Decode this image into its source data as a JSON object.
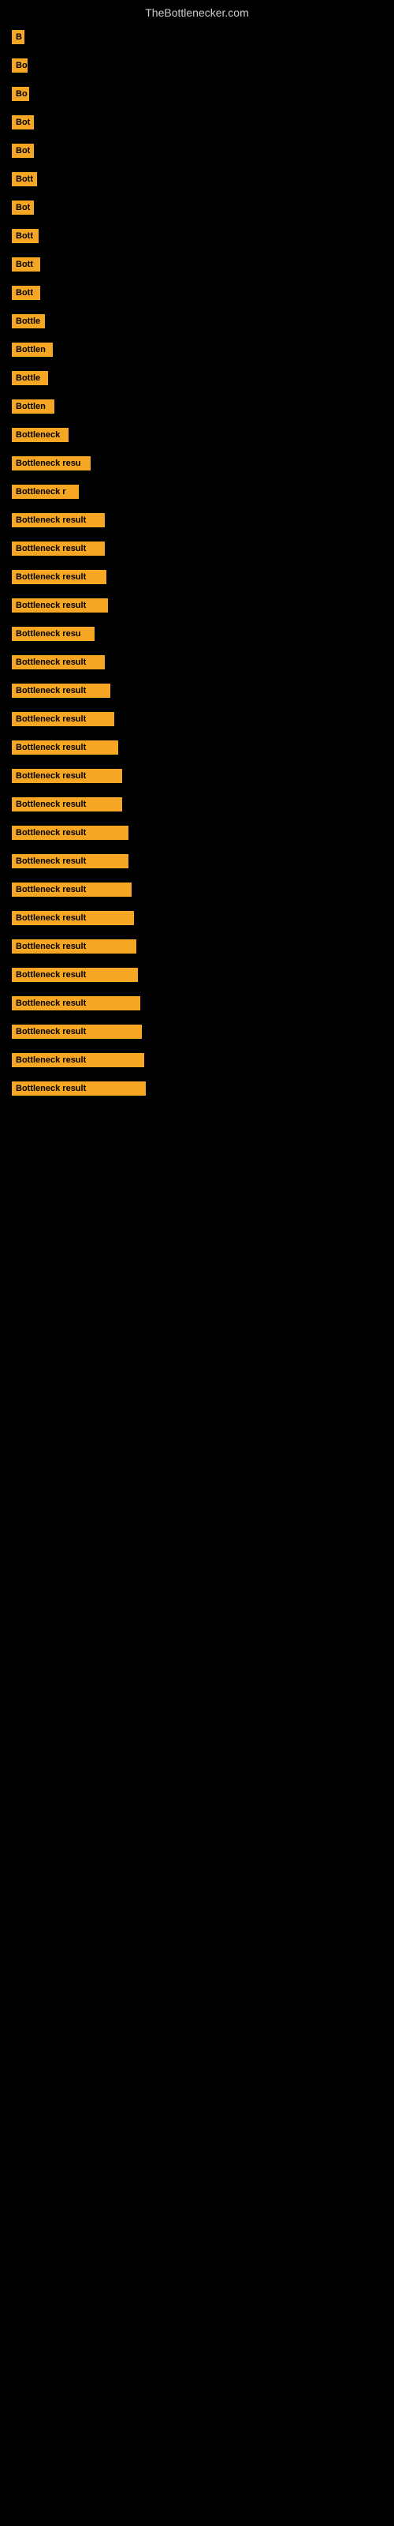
{
  "site": {
    "title": "TheBottlenecker.com"
  },
  "items": [
    {
      "id": 1,
      "label": "B",
      "width": 16
    },
    {
      "id": 2,
      "label": "Bo",
      "width": 20
    },
    {
      "id": 3,
      "label": "Bo",
      "width": 22
    },
    {
      "id": 4,
      "label": "Bot",
      "width": 28
    },
    {
      "id": 5,
      "label": "Bot",
      "width": 28
    },
    {
      "id": 6,
      "label": "Bott",
      "width": 32
    },
    {
      "id": 7,
      "label": "Bot",
      "width": 28
    },
    {
      "id": 8,
      "label": "Bott",
      "width": 34
    },
    {
      "id": 9,
      "label": "Bott",
      "width": 36
    },
    {
      "id": 10,
      "label": "Bott",
      "width": 36
    },
    {
      "id": 11,
      "label": "Bottle",
      "width": 42
    },
    {
      "id": 12,
      "label": "Bottlen",
      "width": 52
    },
    {
      "id": 13,
      "label": "Bottle",
      "width": 46
    },
    {
      "id": 14,
      "label": "Bottlen",
      "width": 54
    },
    {
      "id": 15,
      "label": "Bottleneck",
      "width": 72
    },
    {
      "id": 16,
      "label": "Bottleneck resu",
      "width": 100
    },
    {
      "id": 17,
      "label": "Bottleneck r",
      "width": 85
    },
    {
      "id": 18,
      "label": "Bottleneck result",
      "width": 118
    },
    {
      "id": 19,
      "label": "Bottleneck result",
      "width": 118
    },
    {
      "id": 20,
      "label": "Bottleneck result",
      "width": 120
    },
    {
      "id": 21,
      "label": "Bottleneck result",
      "width": 122
    },
    {
      "id": 22,
      "label": "Bottleneck resu",
      "width": 105
    },
    {
      "id": 23,
      "label": "Bottleneck result",
      "width": 118
    },
    {
      "id": 24,
      "label": "Bottleneck result",
      "width": 125
    },
    {
      "id": 25,
      "label": "Bottleneck result",
      "width": 130
    },
    {
      "id": 26,
      "label": "Bottleneck result",
      "width": 135
    },
    {
      "id": 27,
      "label": "Bottleneck result",
      "width": 140
    },
    {
      "id": 28,
      "label": "Bottleneck result",
      "width": 140
    },
    {
      "id": 29,
      "label": "Bottleneck result",
      "width": 148
    },
    {
      "id": 30,
      "label": "Bottleneck result",
      "width": 148
    },
    {
      "id": 31,
      "label": "Bottleneck result",
      "width": 152
    },
    {
      "id": 32,
      "label": "Bottleneck result",
      "width": 155
    },
    {
      "id": 33,
      "label": "Bottleneck result",
      "width": 158
    },
    {
      "id": 34,
      "label": "Bottleneck result",
      "width": 160
    },
    {
      "id": 35,
      "label": "Bottleneck result",
      "width": 163
    },
    {
      "id": 36,
      "label": "Bottleneck result",
      "width": 165
    },
    {
      "id": 37,
      "label": "Bottleneck result",
      "width": 168
    },
    {
      "id": 38,
      "label": "Bottleneck result",
      "width": 170
    }
  ]
}
